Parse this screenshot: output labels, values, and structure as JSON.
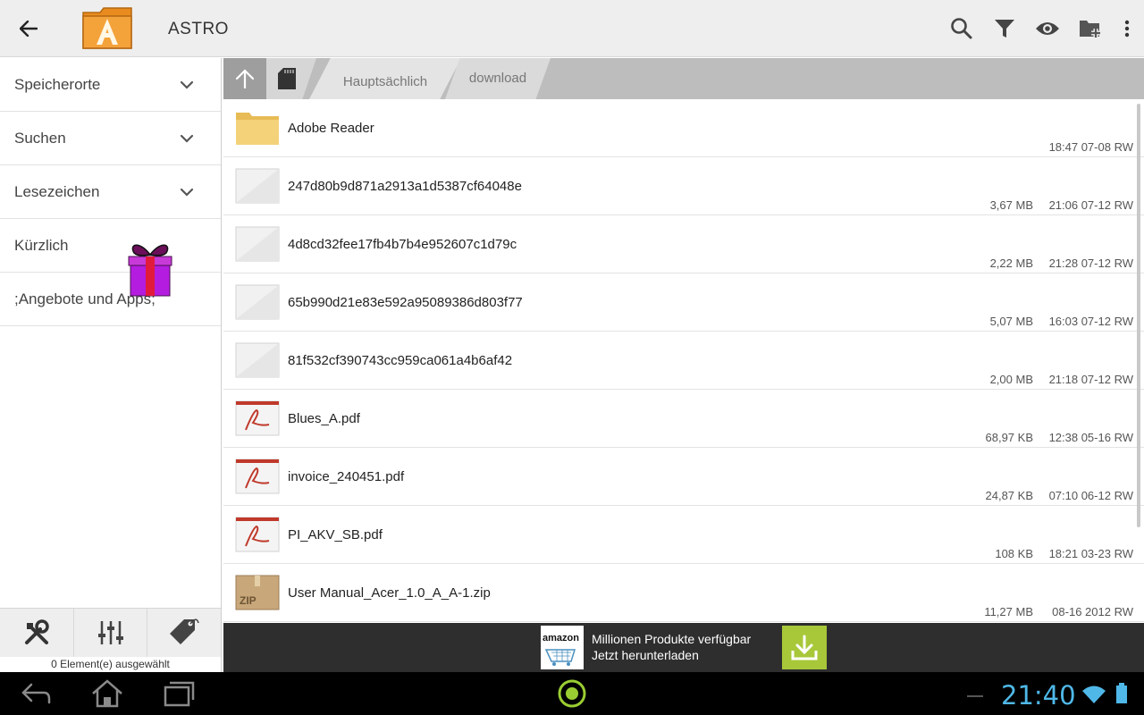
{
  "app": {
    "title": "ASTRO",
    "logo_letter": "A"
  },
  "actionbar": {
    "icons": [
      "back-arrow-icon",
      "search-icon",
      "filter-icon",
      "eye-icon",
      "new-folder-icon",
      "overflow-menu-icon"
    ]
  },
  "sidebar": {
    "items": [
      {
        "label": "Speicherorte",
        "expandable": true
      },
      {
        "label": "Suchen",
        "expandable": true
      },
      {
        "label": "Lesezeichen",
        "expandable": true
      },
      {
        "label": "Kürzlich",
        "expandable": false
      },
      {
        "label": ";Angebote und Apps;",
        "expandable": false
      }
    ],
    "tools": [
      "tools-icon",
      "equalizer-icon",
      "tag-icon"
    ],
    "status": "0 Element(e) ausgewählt"
  },
  "breadcrumb": {
    "items": [
      "Hauptsächlich",
      "download"
    ]
  },
  "files": [
    {
      "name": "Adobe Reader",
      "type": "folder",
      "size": "",
      "meta": "18:47 07-08 RW"
    },
    {
      "name": "247d80b9d871a2913a1d5387cf64048e",
      "type": "file",
      "size": "3,67 MB",
      "meta": "21:06 07-12 RW"
    },
    {
      "name": "4d8cd32fee17fb4b7b4e952607c1d79c",
      "type": "file",
      "size": "2,22 MB",
      "meta": "21:28 07-12 RW"
    },
    {
      "name": "65b990d21e83e592a95089386d803f77",
      "type": "file",
      "size": "5,07 MB",
      "meta": "16:03 07-12 RW"
    },
    {
      "name": "81f532cf390743cc959ca061a4b6af42",
      "type": "file",
      "size": "2,00 MB",
      "meta": "21:18 07-12 RW"
    },
    {
      "name": "Blues_A.pdf",
      "type": "pdf",
      "size": "68,97 KB",
      "meta": "12:38 05-16 RW"
    },
    {
      "name": "invoice_240451.pdf",
      "type": "pdf",
      "size": "24,87 KB",
      "meta": "07:10 06-12 RW"
    },
    {
      "name": "PI_AKV_SB.pdf",
      "type": "pdf",
      "size": "108 KB",
      "meta": "18:21 03-23 RW"
    },
    {
      "name": "User Manual_Acer_1.0_A_A-1.zip",
      "type": "zip",
      "size": "11,27 MB",
      "meta": "08-16 2012 RW"
    }
  ],
  "ad": {
    "brand": "amazon",
    "line1": "Millionen Produkte verfügbar",
    "line2": "Jetzt herunterladen"
  },
  "system": {
    "time": "21:40"
  },
  "colors": {
    "accent_blue": "#4fb8e8",
    "ad_green": "#a8c83a",
    "folder_yellow": "#f3d27a",
    "pdf_red": "#c0392b"
  }
}
